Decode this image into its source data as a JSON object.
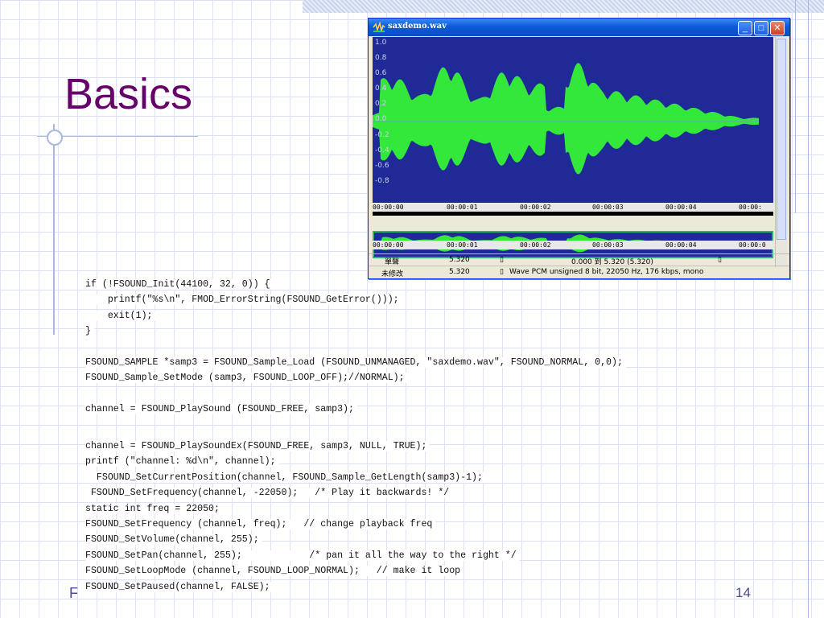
{
  "slide": {
    "title": "Basics",
    "footer_left": "F",
    "page_number": "14"
  },
  "window": {
    "title": "saxdemo.wav",
    "minimize": "_",
    "maximize": "□",
    "close": "✕",
    "amplitude_ticks": [
      "1.0",
      "0.8",
      "0.6",
      "0.4",
      "0.2",
      "0.0",
      "-0.2",
      "-0.4",
      "-0.6",
      "-0.8"
    ],
    "time_ticks": [
      "00:00:00",
      "00:00:01",
      "00:00:02",
      "00:00:03",
      "00:00:04",
      "00:00:"
    ],
    "mini_time_ticks": [
      "00:00:00",
      "00:00:01",
      "00:00:02",
      "00:00:03",
      "00:00:04",
      "00:00:0"
    ],
    "status_rows": [
      {
        "label": "單聲",
        "value": "5.320",
        "icon": "▯",
        "info": "0.000 到 5.320 (5.320)",
        "icon2": "▯"
      },
      {
        "label": "未修改",
        "value": "5.320",
        "icon": "▯",
        "info": "Wave PCM unsigned 8 bit, 22050 Hz, 176 kbps, mono"
      }
    ],
    "waveform_color": "#33e83a",
    "background_color": "#1f2a96"
  },
  "code_lines": [
    "if (!FSOUND_Init(44100, 32, 0)) {",
    "    printf(\"%s\\n\", FMOD_ErrorString(FSOUND_GetError()));",
    "    exit(1);",
    "}",
    "",
    "FSOUND_SAMPLE *samp3 = FSOUND_Sample_Load (FSOUND_UNMANAGED, \"saxdemo.wav\", FSOUND_NORMAL, 0,0);",
    "FSOUND_Sample_SetMode (samp3, FSOUND_LOOP_OFF);//NORMAL);",
    "",
    "channel = FSOUND_PlaySound (FSOUND_FREE, samp3);",
    "",
    "channel = FSOUND_PlaySoundEx(FSOUND_FREE, samp3, NULL, TRUE);",
    "printf (\"channel: %d\\n\", channel);",
    "  FSOUND_SetCurrentPosition(channel, FSOUND_Sample_GetLength(samp3)-1);",
    " FSOUND_SetFrequency(channel, -22050);   /* Play it backwards! */",
    "static int freq = 22050;",
    "FSOUND_SetFrequency (channel, freq);   // change playback freq",
    "FSOUND_SetVolume(channel, 255);",
    "FSOUND_SetPan(channel, 255);            /* pan it all the way to the right */",
    "FSOUND_SetLoopMode (channel, FSOUND_LOOP_NORMAL);   // make it loop",
    "FSOUND_SetPaused(channel, FALSE);"
  ]
}
